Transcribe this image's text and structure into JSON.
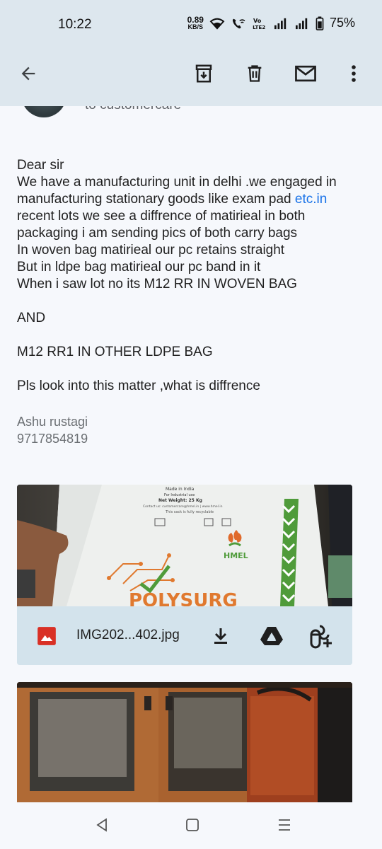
{
  "status_bar": {
    "time": "10:22",
    "net_speed_value": "0.89",
    "net_speed_unit": "KB/S",
    "battery": "75%",
    "icons": [
      "wifi-icon",
      "wifi-call-icon",
      "volte-icon",
      "signal-icon",
      "signal-icon",
      "battery-icon"
    ]
  },
  "toolbar": {
    "icons": [
      "back-arrow-icon",
      "archive-icon",
      "delete-icon",
      "mark-unread-icon",
      "more-vert-icon"
    ]
  },
  "email": {
    "recipient_partial": "to customercare",
    "body": {
      "greeting": "Dear sir",
      "line1": "We have a manufacturing unit in delhi .we engaged in",
      "line2_prefix": "manufacturing stationary goods like exam pad ",
      "line2_link": "etc.in",
      "line3": "recent lots we see a diffrence of matirieal in both",
      "line4": "packaging i am sending pics of both carry bags",
      "line5": "In woven bag matirieal our pc retains straight",
      "line6": "But in ldpe bag matirieal our pc band in it",
      "line7": "When i saw lot no its M12 RR IN WOVEN BAG",
      "line8": "AND",
      "line9": "M12 RR1 IN OTHER LDPE BAG",
      "line10": "Pls look into this matter ,what is diffrence"
    },
    "signature": {
      "name": "Ashu rustagi",
      "phone": "9717854819"
    }
  },
  "attachments": [
    {
      "filename": "IMG202...402.jpg",
      "photo_text": {
        "made_in": "Made in India",
        "for_use": "For Industrial use",
        "net_weight": "Net Weight: 25 Kg",
        "contact": "Contact us: customercare@hmel.in | www.hmel.in",
        "recyclable": "This sack is fully recyclable",
        "brand": "HMEL",
        "product_partial": "POLYSURG"
      },
      "actions": [
        "download-icon",
        "drive-icon",
        "photos-add-icon"
      ]
    },
    {
      "filename": ""
    }
  ],
  "nav": {
    "icons": [
      "back-triangle-icon",
      "home-square-icon",
      "recents-menu-icon"
    ]
  },
  "colors": {
    "band": "#dde7ee",
    "background": "#f6f8fc",
    "link": "#1a73e8",
    "attachment_bar": "#d3e3ec",
    "image_icon_red": "#d93025"
  }
}
